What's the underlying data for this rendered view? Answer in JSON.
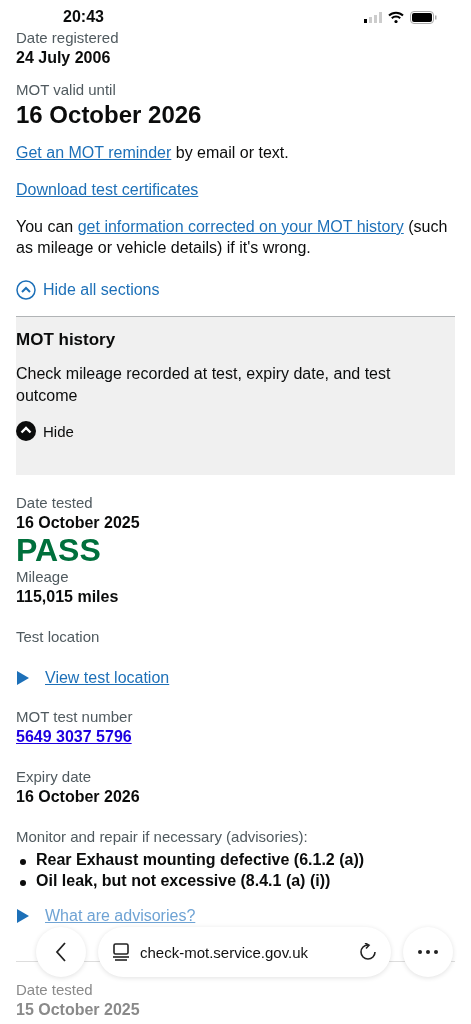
{
  "status_bar": {
    "time": "20:43"
  },
  "summary": [
    {
      "label": "Date registered",
      "value": "24 July 2006",
      "kind": "small"
    },
    {
      "label": "MOT valid until",
      "value": "16 October 2026",
      "kind": "large"
    }
  ],
  "reminder": {
    "link": "Get an MOT reminder",
    "rest": " by email or text."
  },
  "download_link": "Download test certificates",
  "correction": {
    "before": "You can ",
    "link": "get information corrected on your MOT history",
    "after": " (such as mileage or vehicle details) if it's wrong."
  },
  "toggle_all": {
    "label": "Hide all sections",
    "expanded": true
  },
  "section": {
    "title": "MOT history",
    "summary": "Check mileage recorded at test, expiry date, and test outcome",
    "toggle": {
      "label": "Hide",
      "expanded": true
    }
  },
  "test": {
    "date_label": "Date tested",
    "date": "16 October 2025",
    "result": "PASS",
    "mileage_label": "Mileage",
    "mileage": "115,015 miles",
    "location_label": "Test location",
    "location_link": {
      "label": "View test location",
      "expanded": false
    },
    "number_label": "MOT test number",
    "number": "5649 3037 5796",
    "expiry_label": "Expiry date",
    "expiry": "16 October 2026",
    "advisories_label": "Monitor and repair if necessary (advisories):",
    "advisories": [
      "Rear Exhaust mounting defective (6.1.2 (a))",
      "Oil leak, but not excessive (8.4.1 (a) (i))"
    ],
    "advisories_link": {
      "label": "What are advisories?",
      "expanded": false
    }
  },
  "next_test": {
    "date_label": "Date tested",
    "date": "15 October 2025"
  },
  "browser_bar": {
    "url": "check-mot.service.gov.uk"
  }
}
